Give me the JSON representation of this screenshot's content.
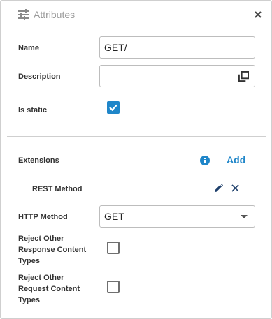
{
  "header": {
    "title": "Attributes",
    "icon": "sliders-icon",
    "close_icon": "close-icon"
  },
  "fields": {
    "name_label": "Name",
    "name_value": "GET/",
    "description_label": "Description",
    "description_value": "",
    "description_icon": "copy-icon",
    "is_static_label": "Is static",
    "is_static_checked": true
  },
  "extensions": {
    "label": "Extensions",
    "info_icon": "info-icon",
    "add_label": "Add",
    "items": [
      {
        "label": "REST Method",
        "edit_icon": "pencil-icon",
        "remove_icon": "close-icon"
      }
    ]
  },
  "rest": {
    "http_method_label": "HTTP Method",
    "http_method_value": "GET",
    "reject_response_label": [
      "Reject Other",
      "Response Content",
      "Types"
    ],
    "reject_response_checked": false,
    "reject_request_label": [
      "Reject Other",
      "Request Content",
      "Types"
    ],
    "reject_request_checked": false
  },
  "colors": {
    "accent": "#1f86c9",
    "label": "#333333",
    "border": "#bdbdbd",
    "title": "#9a9a9a"
  }
}
